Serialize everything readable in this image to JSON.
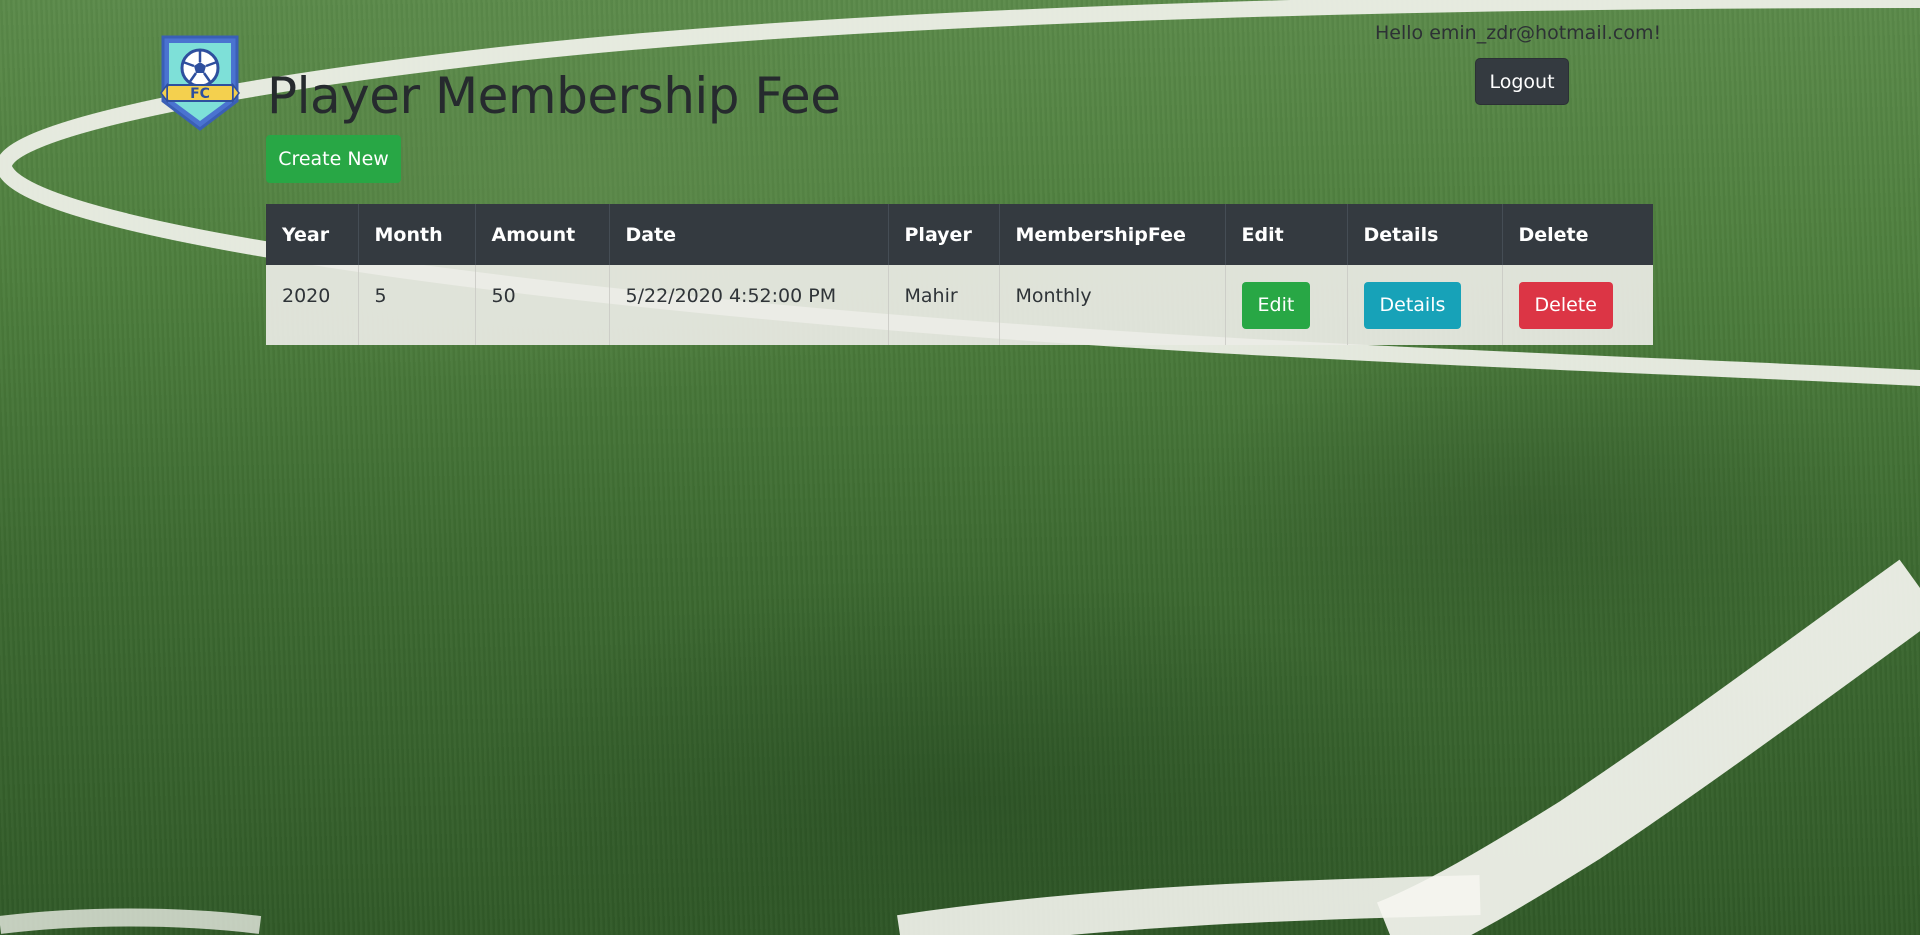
{
  "header": {
    "title": "Player Membership Fee",
    "greeting": "Hello emin_zdr@hotmail.com!",
    "logout_label": "Logout",
    "logo_text": "FC"
  },
  "actions": {
    "create_label": "Create New"
  },
  "table": {
    "columns": [
      "Year",
      "Month",
      "Amount",
      "Date",
      "Player",
      "MembershipFee",
      "Edit",
      "Details",
      "Delete"
    ],
    "rows": [
      {
        "year": "2020",
        "month": "5",
        "amount": "50",
        "date": "5/22/2020 4:52:00 PM",
        "player": "Mahir",
        "membership_fee": "Monthly",
        "edit_label": "Edit",
        "details_label": "Details",
        "delete_label": "Delete"
      }
    ]
  },
  "colors": {
    "success": "#28a745",
    "info": "#17a2b8",
    "danger": "#dc3545",
    "dark": "#343a40"
  }
}
